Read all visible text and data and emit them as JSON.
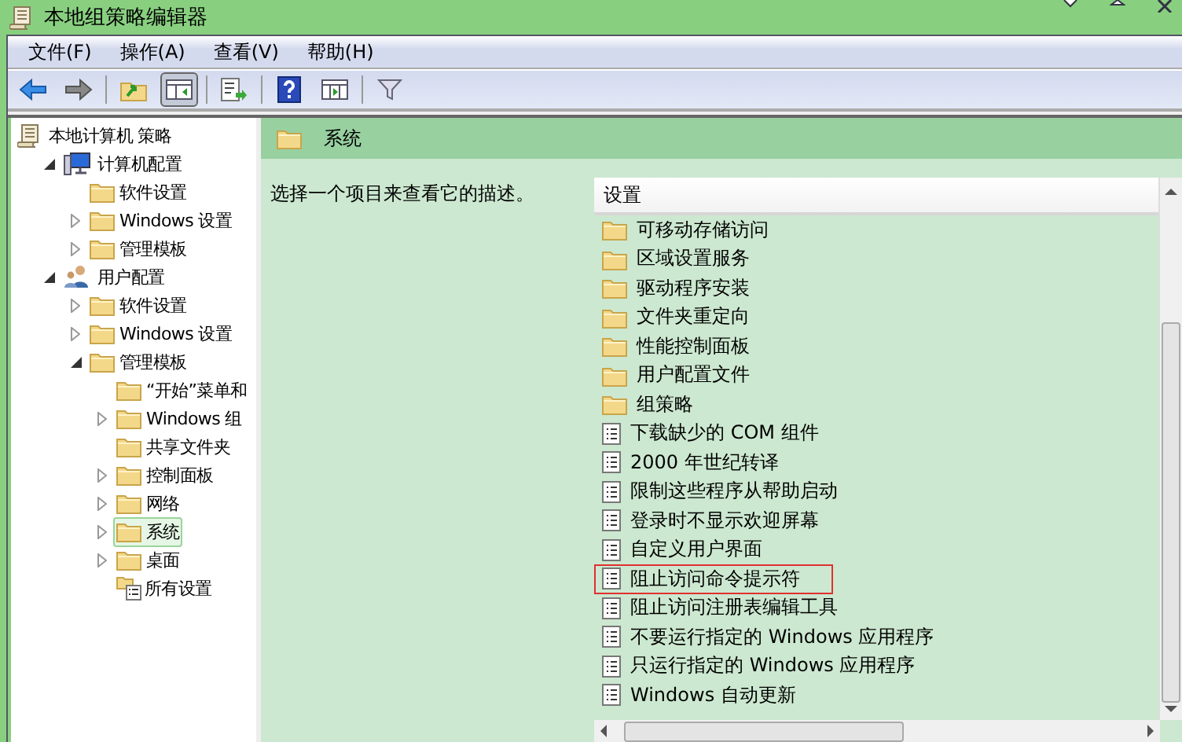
{
  "window": {
    "title": "本地组策略编辑器"
  },
  "menu": [
    {
      "label": "文件(F)"
    },
    {
      "label": "操作(A)"
    },
    {
      "label": "查看(V)"
    },
    {
      "label": "帮助(H)"
    }
  ],
  "toolbar": [
    {
      "kind": "back",
      "pressed": false
    },
    {
      "kind": "forward",
      "pressed": false
    },
    {
      "kind": "sep"
    },
    {
      "kind": "up",
      "pressed": false
    },
    {
      "kind": "tree",
      "pressed": true
    },
    {
      "kind": "sep"
    },
    {
      "kind": "export",
      "pressed": false
    },
    {
      "kind": "sep"
    },
    {
      "kind": "help",
      "pressed": false
    },
    {
      "kind": "pane",
      "pressed": false
    },
    {
      "kind": "sep"
    },
    {
      "kind": "filter",
      "pressed": false
    }
  ],
  "tree": [
    {
      "label": "本地计算机 策略",
      "kind": "policy",
      "selected": false,
      "children": [
        {
          "label": "计算机配置",
          "kind": "computer",
          "expanded": true,
          "selected": false,
          "children": [
            {
              "label": "软件设置",
              "kind": "folder",
              "selected": false
            },
            {
              "label": "Windows 设置",
              "kind": "folder",
              "expanded": false,
              "selected": false
            },
            {
              "label": "管理模板",
              "kind": "folder",
              "expanded": false,
              "selected": false
            }
          ]
        },
        {
          "label": "用户配置",
          "kind": "user",
          "expanded": true,
          "selected": false,
          "children": [
            {
              "label": "软件设置",
              "kind": "folder",
              "expanded": false,
              "selected": false
            },
            {
              "label": "Windows 设置",
              "kind": "folder",
              "expanded": false,
              "selected": false
            },
            {
              "label": "管理模板",
              "kind": "folder",
              "expanded": true,
              "selected": false,
              "children": [
                {
                  "label": "“开始”菜单和",
                  "kind": "folder",
                  "selected": false
                },
                {
                  "label": "Windows 组",
                  "kind": "folder",
                  "expanded": false,
                  "selected": false
                },
                {
                  "label": "共享文件夹",
                  "kind": "folder",
                  "selected": false
                },
                {
                  "label": "控制面板",
                  "kind": "folder",
                  "expanded": false,
                  "selected": false
                },
                {
                  "label": "网络",
                  "kind": "folder",
                  "expanded": false,
                  "selected": false
                },
                {
                  "label": "系统",
                  "kind": "folder",
                  "expanded": false,
                  "selected": true
                },
                {
                  "label": "桌面",
                  "kind": "folder",
                  "expanded": false,
                  "selected": false
                },
                {
                  "label": "所有设置",
                  "kind": "allsettings",
                  "selected": false
                }
              ]
            }
          ]
        }
      ]
    }
  ],
  "details": {
    "title": "系统",
    "description": "选择一个项目来查看它的描述。",
    "column": "设置",
    "rows": [
      {
        "kind": "folder",
        "label": "可移动存储访问",
        "highlighted": false
      },
      {
        "kind": "folder",
        "label": "区域设置服务",
        "highlighted": false
      },
      {
        "kind": "folder",
        "label": "驱动程序安装",
        "highlighted": false
      },
      {
        "kind": "folder",
        "label": "文件夹重定向",
        "highlighted": false
      },
      {
        "kind": "folder",
        "label": "性能控制面板",
        "highlighted": false
      },
      {
        "kind": "folder",
        "label": "用户配置文件",
        "highlighted": false
      },
      {
        "kind": "folder",
        "label": "组策略",
        "highlighted": false
      },
      {
        "kind": "setting",
        "label": "下载缺少的 COM 组件",
        "highlighted": false
      },
      {
        "kind": "setting",
        "label": "2000 年世纪转译",
        "highlighted": false
      },
      {
        "kind": "setting",
        "label": "限制这些程序从帮助启动",
        "highlighted": false
      },
      {
        "kind": "setting",
        "label": "登录时不显示欢迎屏幕",
        "highlighted": false
      },
      {
        "kind": "setting",
        "label": "自定义用户界面",
        "highlighted": false
      },
      {
        "kind": "setting",
        "label": "阻止访问命令提示符",
        "highlighted": true
      },
      {
        "kind": "setting",
        "label": "阻止访问注册表编辑工具",
        "highlighted": false
      },
      {
        "kind": "setting",
        "label": "不要运行指定的 Windows 应用程序",
        "highlighted": false
      },
      {
        "kind": "setting",
        "label": "只运行指定的 Windows 应用程序",
        "highlighted": false
      },
      {
        "kind": "setting",
        "label": "Windows 自动更新",
        "highlighted": false
      }
    ]
  }
}
